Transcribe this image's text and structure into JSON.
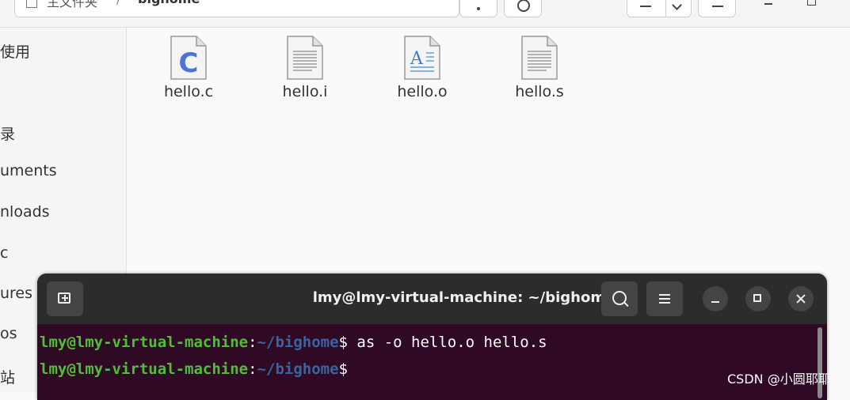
{
  "file_manager": {
    "path": {
      "root": "主文件夹",
      "separator": "/",
      "current": "bighome"
    },
    "sidebar": {
      "items": [
        {
          "label": "使用"
        },
        {
          "label": "录"
        },
        {
          "label": "uments"
        },
        {
          "label": "nloads"
        },
        {
          "label": "c"
        },
        {
          "label": "ures"
        },
        {
          "label": "os"
        },
        {
          "label": "站"
        }
      ]
    },
    "files": [
      {
        "name": "hello.c",
        "icon": "c-source-icon"
      },
      {
        "name": "hello.i",
        "icon": "text-file-icon"
      },
      {
        "name": "hello.o",
        "icon": "document-file-icon"
      },
      {
        "name": "hello.s",
        "icon": "text-file-icon"
      }
    ]
  },
  "terminal": {
    "title": "lmy@lmy-virtual-machine: ~/bighome",
    "lines": [
      {
        "user": "lmy@lmy-virtual-machine",
        "colon": ":",
        "path": "~/bighome",
        "dollar": "$",
        "command": " as -o hello.o hello.s"
      },
      {
        "user": "lmy@lmy-virtual-machine",
        "colon": ":",
        "path": "~/bighome",
        "dollar": "$",
        "command": ""
      }
    ]
  },
  "watermark": "CSDN @小圆耶耶",
  "colors": {
    "terminal_bg": "#300a24",
    "prompt_user": "#4fbf3a",
    "prompt_path": "#3465a4"
  }
}
